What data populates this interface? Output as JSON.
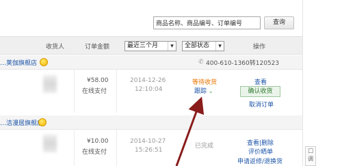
{
  "search": {
    "value": "商品名称、商品编号、订单编号",
    "button": "查询"
  },
  "header": {
    "consignee": "收货人",
    "amount": "订单金额",
    "time_filter": "最近三个月",
    "status_filter": "全部状态",
    "actions": "操作"
  },
  "orders": [
    {
      "shop": "…荚伽旗舰店",
      "phone": "400-610-1360转120523",
      "price": "¥58.00",
      "payment": "在线支付",
      "date": "2014-12-26",
      "time": "12:10:04",
      "status": "等待收货",
      "track": "跟踪",
      "view": "查看",
      "confirm": "确认收货",
      "cancel": "取消订单"
    },
    {
      "shop": "…洁漫居旗舰店",
      "price": "¥10.00",
      "payment": "在线支付",
      "date": "2014-10-27",
      "time": "15:26:51",
      "status": "已完成",
      "view_delete": "查看|删除",
      "review": "评价晒单",
      "return": "申请返修/退换货"
    }
  ],
  "side_widget": {
    "label": "调"
  },
  "colors": {
    "link": "#1d55a8",
    "status_pending": "#e97400",
    "arrow": "#8a1c1c"
  },
  "icons": [
    "wangwang-chat-icon",
    "phone-icon",
    "chevron-down-icon",
    "feedback-icon"
  ]
}
